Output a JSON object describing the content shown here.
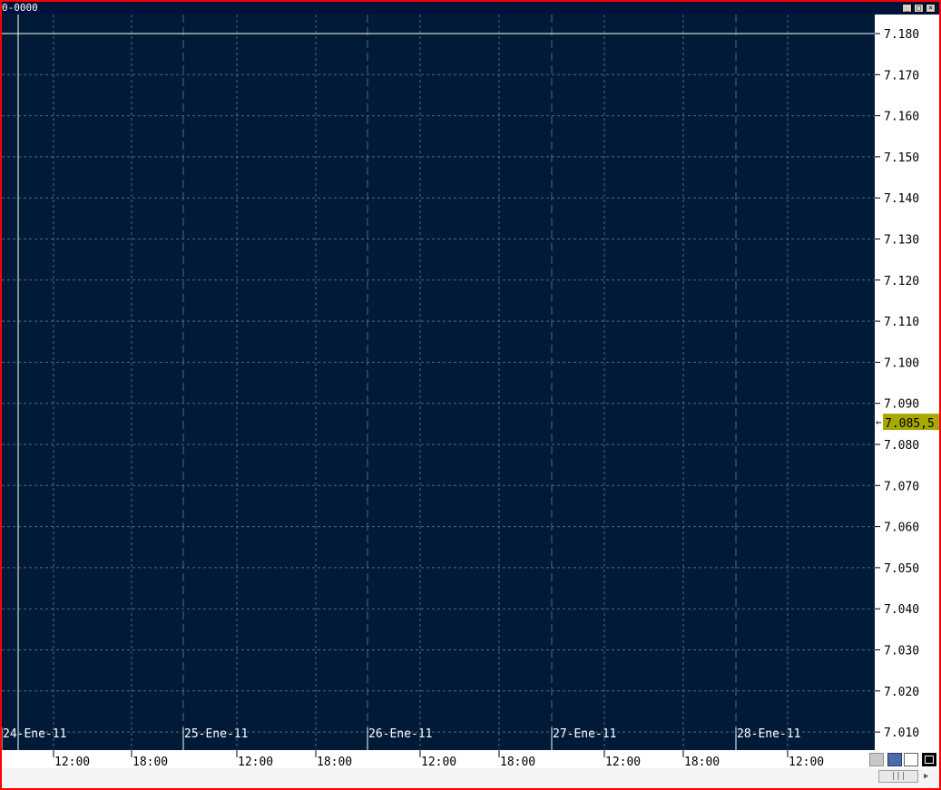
{
  "window": {
    "title": "0-0000",
    "minimize_glyph": "_",
    "maximize_glyph": "□",
    "close_glyph": "×"
  },
  "chart_data": {
    "type": "line",
    "y_ticks": [
      "7.180",
      "7.170",
      "7.160",
      "7.150",
      "7.140",
      "7.130",
      "7.120",
      "7.110",
      "7.100",
      "7.090",
      "7.080",
      "7.070",
      "7.060",
      "7.050",
      "7.040",
      "7.030",
      "7.020",
      "7.010"
    ],
    "ylim": [
      7.005,
      7.185
    ],
    "current_price_label": "7.085,5",
    "current_price": 7.0855,
    "crosshair_price": 7.18,
    "date_labels": [
      "24-Ene-11",
      "25-Ene-11",
      "26-Ene-11",
      "27-Ene-11",
      "28-Ene-11"
    ],
    "time_labels": [
      "12:00",
      "18:00",
      "12:00",
      "18:00",
      "12:00",
      "18:00",
      "12:00",
      "18:00",
      "12:00"
    ],
    "grid": true
  },
  "colors": {
    "background": "#001a38",
    "grid": "#4a6a8a",
    "crosshair": "#ffffff",
    "price_tag": "#a8a800",
    "border": "#ff0000"
  },
  "statusbar": {
    "scroll_glyph": "|||",
    "arrow_glyph": "▶"
  }
}
